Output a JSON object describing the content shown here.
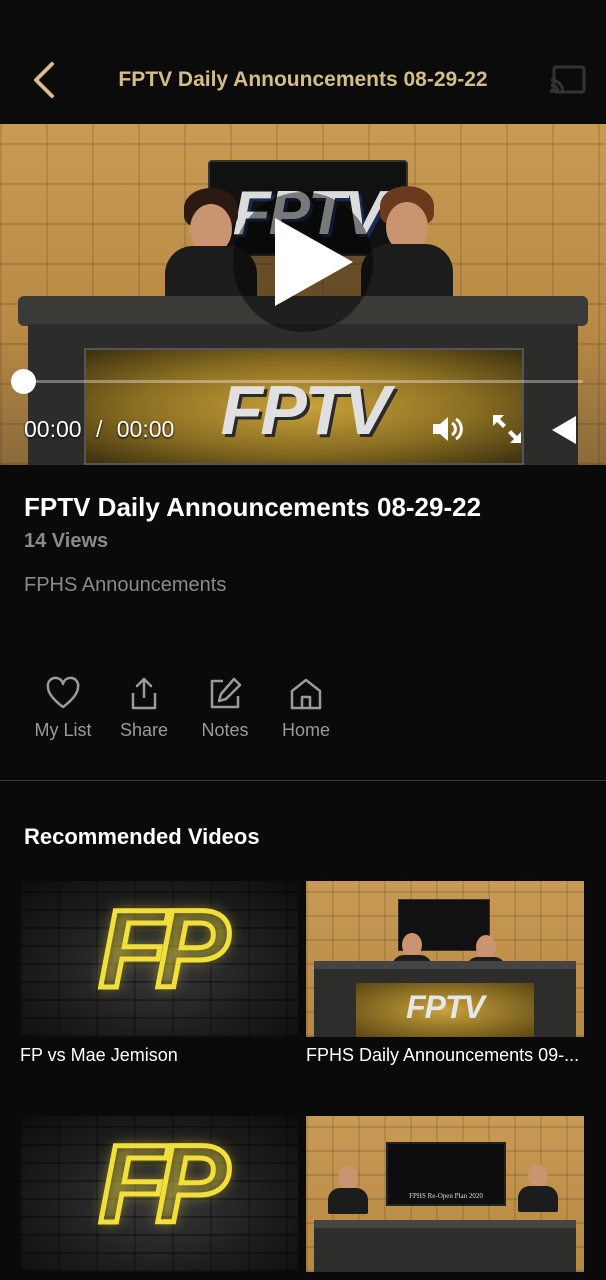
{
  "header": {
    "title": "FPTV Daily Announcements 08-29-22",
    "back_icon": "chevron-left-icon",
    "cast_icon": "cast-icon",
    "accent_color": "#d6bd86"
  },
  "player": {
    "wall_sign_text": "FPTV",
    "desk_panel_text": "FPTV",
    "current_time": "00:00",
    "separator": "/",
    "duration": "00:00",
    "progress": 0,
    "icons": [
      "play-icon",
      "volume-icon",
      "fullscreen-icon",
      "airplay-icon"
    ]
  },
  "video": {
    "title": "FPTV Daily Announcements 08-29-22",
    "views": "14 Views",
    "channel": "FPHS Announcements"
  },
  "actions": [
    {
      "label": "My List",
      "icon": "heart-icon"
    },
    {
      "label": "Share",
      "icon": "share-icon"
    },
    {
      "label": "Notes",
      "icon": "edit-icon"
    },
    {
      "label": "Home",
      "icon": "home-icon"
    }
  ],
  "recommended": {
    "title": "Recommended Videos",
    "items": [
      {
        "title": "FP vs Mae Jemison",
        "thumb_logo": "FP"
      },
      {
        "title": "FPHS Daily Announcements 09-...",
        "thumb_panel_text": "FPTV"
      },
      {
        "title": "",
        "thumb_logo": "FP"
      },
      {
        "title": "",
        "thumb_tv_text": "FPHS Re-Open Plan 2020"
      }
    ]
  }
}
